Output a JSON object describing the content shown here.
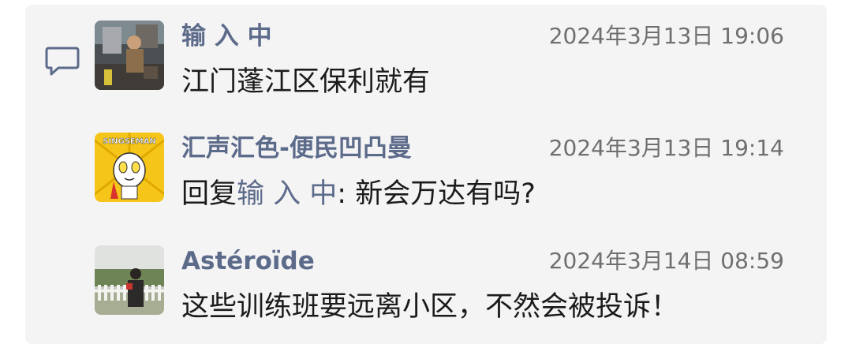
{
  "icons": {
    "comment": "speech-bubble-icon"
  },
  "colors": {
    "panel_bg": "#f4f4f5",
    "name": "#5d6b8a",
    "time": "#6f6f6f",
    "text": "#1b1b1b"
  },
  "comments": [
    {
      "name": "输 入 中",
      "time": "2024年3月13日 19:06",
      "text": "江门蓬江区保利就有",
      "avatar": "photo-avatar-figure"
    },
    {
      "name": "汇声汇色-便民凹凸曼",
      "time": "2024年3月13日 19:14",
      "reply_prefix": "回复",
      "reply_to": "输 入 中",
      "reply_sep": ": ",
      "text": "新会万达有吗?",
      "avatar": "cartoon-avatar-singseman",
      "avatar_label": "SINGSEMAN"
    },
    {
      "name": "Astéroïde",
      "time": "2024年3月14日 08:59",
      "text": "这些训练班要远离小区，不然会被投诉！",
      "avatar": "photo-avatar-outdoor"
    }
  ]
}
